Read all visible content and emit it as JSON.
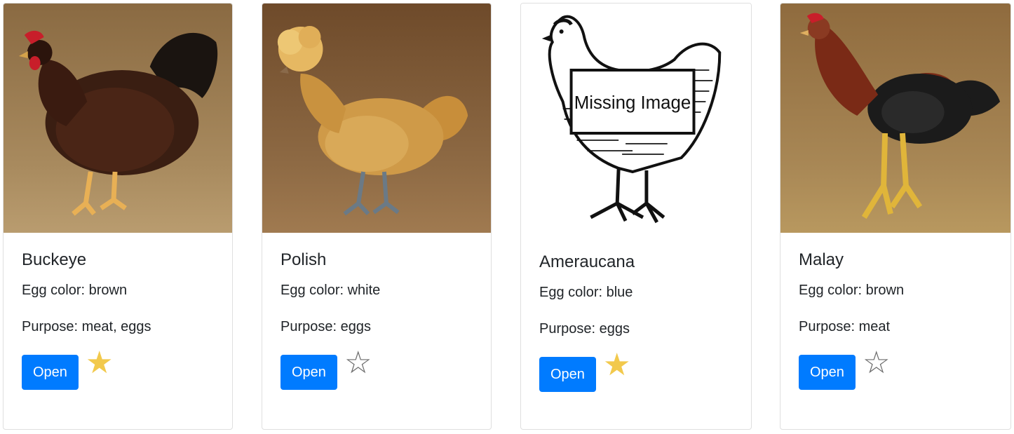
{
  "cards": [
    {
      "name": "Buckeye",
      "egg_color": "Egg color: brown",
      "purpose": "Purpose: meat, eggs",
      "button": "Open",
      "favorite": true,
      "star": "★"
    },
    {
      "name": "Polish",
      "egg_color": "Egg color: white",
      "purpose": "Purpose: eggs",
      "button": "Open",
      "favorite": false,
      "star": "☆"
    },
    {
      "name": "Ameraucana",
      "egg_color": "Egg color: blue",
      "purpose": "Purpose: eggs",
      "button": "Open",
      "favorite": true,
      "star": "★",
      "image_label": "Missing Image"
    },
    {
      "name": "Malay",
      "egg_color": "Egg color: brown",
      "purpose": "Purpose: meat",
      "button": "Open",
      "favorite": false,
      "star": "☆"
    }
  ],
  "colors": {
    "primary": "#007bff",
    "star_filled": "#f2c94c",
    "star_empty": "#6c6c6c"
  }
}
